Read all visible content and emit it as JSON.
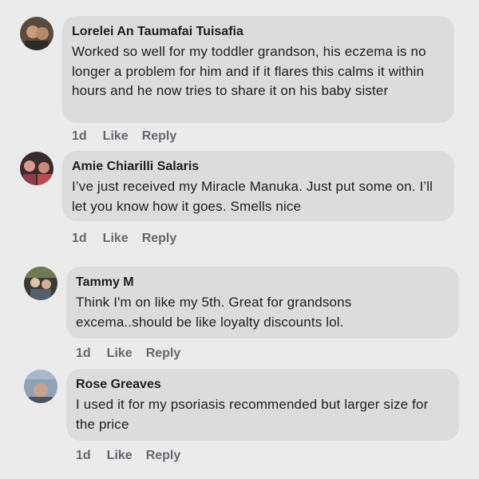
{
  "comments": [
    {
      "author": "Lorelei An Taumafai Tuisafia",
      "text": "Worked so well for my toddler grandson, his eczema is no longer a problem for him and if it flares this calms it within hours and he now tries to share it on his baby sister",
      "time": "1d",
      "like_label": "Like",
      "reply_label": "Reply",
      "avatar_colors": [
        "#5a4a3e",
        "#c89b7b",
        "#2e2a28"
      ]
    },
    {
      "author": "Amie Chiarilli Salaris",
      "text": "I’ve just received my Miracle Manuka. Just put some on. I’ll let you know how it goes. Smells nice",
      "time": "1d",
      "like_label": "Like",
      "reply_label": "Reply",
      "avatar_colors": [
        "#8a3f4b",
        "#d99c8c",
        "#3b2a2e"
      ]
    },
    {
      "author": "Tammy M",
      "text": "Think I'm on like my 5th. Great for grandsons excema..should be like loyalty discounts lol.",
      "time": "1d",
      "like_label": "Like",
      "reply_label": "Reply",
      "avatar_colors": [
        "#6f7a54",
        "#e0c3a6",
        "#3a3a36"
      ]
    },
    {
      "author": "Rose Greaves",
      "text": "I used it for my psoriasis recommended but larger size for the price",
      "time": "1d",
      "like_label": "Like",
      "reply_label": "Reply",
      "avatar_colors": [
        "#8fa3b8",
        "#c8a48e",
        "#4a5566"
      ]
    }
  ]
}
